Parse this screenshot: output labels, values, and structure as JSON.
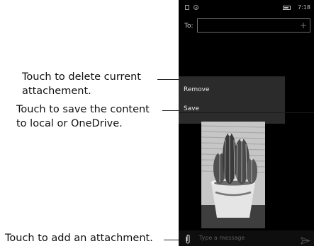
{
  "annotations": {
    "delete_line1": "Touch to delete current",
    "delete_line2": "attachement.",
    "save_line1": "Touch to save the content",
    "save_line2": "to local or OneDrive.",
    "attach": "Touch to add an attachment."
  },
  "status_bar": {
    "time": "7:18",
    "icons": [
      "sim-icon",
      "location-icon",
      "battery-icon"
    ]
  },
  "recipient": {
    "label": "To:",
    "value": "",
    "add_icon": "+"
  },
  "context_menu": {
    "items": [
      "Remove",
      "Save"
    ]
  },
  "attachment": {
    "type": "photo",
    "subject": "cactus-in-pot-image"
  },
  "composer": {
    "placeholder": "Type a message",
    "attach_icon": "paperclip-icon",
    "send_icon": "send-icon"
  }
}
